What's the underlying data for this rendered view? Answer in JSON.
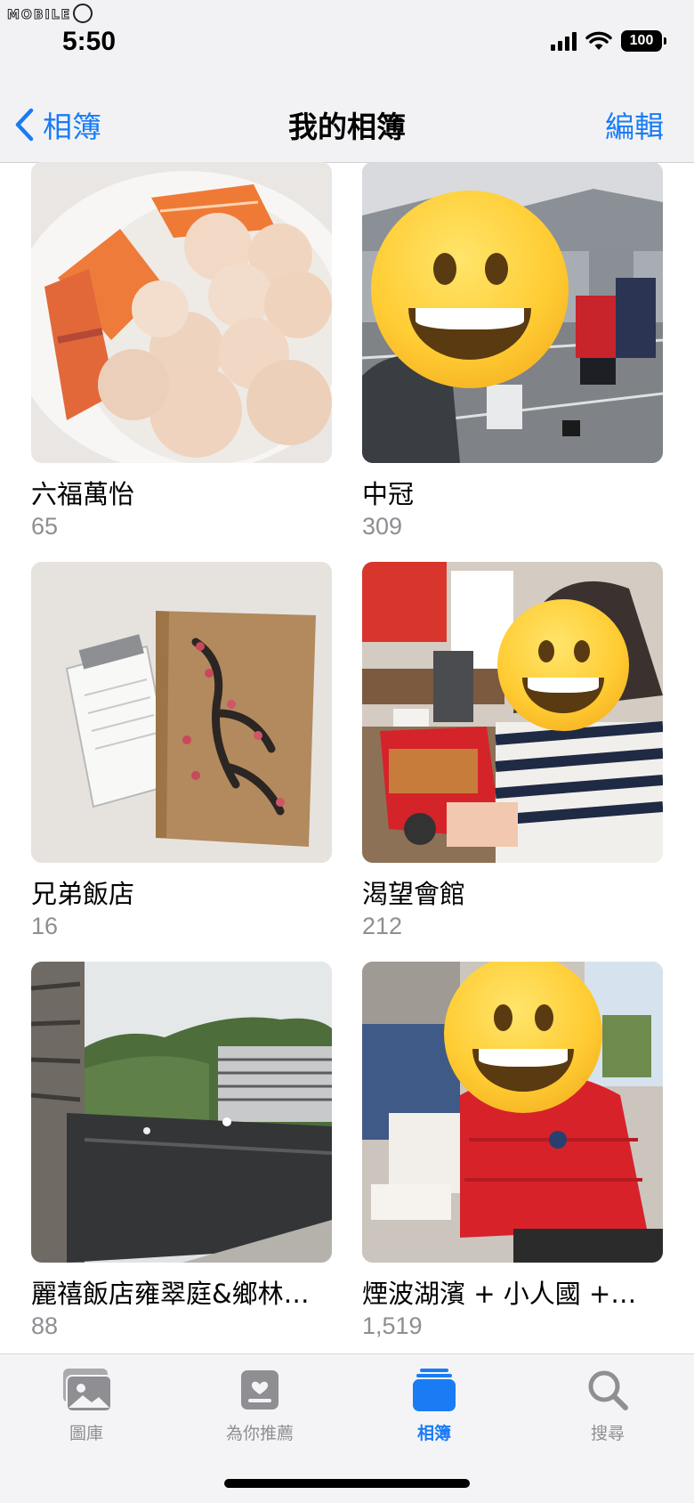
{
  "watermark": "MOBILE",
  "status_bar": {
    "time": "5:50",
    "battery": "100"
  },
  "nav": {
    "back_label": "相簿",
    "title": "我的相簿",
    "edit_label": "編輯"
  },
  "albums": [
    {
      "title": "六福萬怡",
      "count": "65"
    },
    {
      "title": "中冠",
      "count": "309"
    },
    {
      "title": "兄弟飯店",
      "count": "16"
    },
    {
      "title": "渴望會館",
      "count": "212"
    },
    {
      "title": "麗禧飯店雍翠庭&鄉林…",
      "count": "88"
    },
    {
      "title": "煙波湖濱 + 小人國 +…",
      "count": "1,519"
    }
  ],
  "tabs": [
    {
      "label": "圖庫",
      "icon": "photo-library-icon"
    },
    {
      "label": "為你推薦",
      "icon": "for-you-icon"
    },
    {
      "label": "相簿",
      "icon": "albums-icon",
      "active": true
    },
    {
      "label": "搜尋",
      "icon": "search-icon"
    }
  ],
  "colors": {
    "accent": "#1a7cf5",
    "secondary_text": "#8e8e93",
    "bar_background": "#f2f2f4"
  }
}
